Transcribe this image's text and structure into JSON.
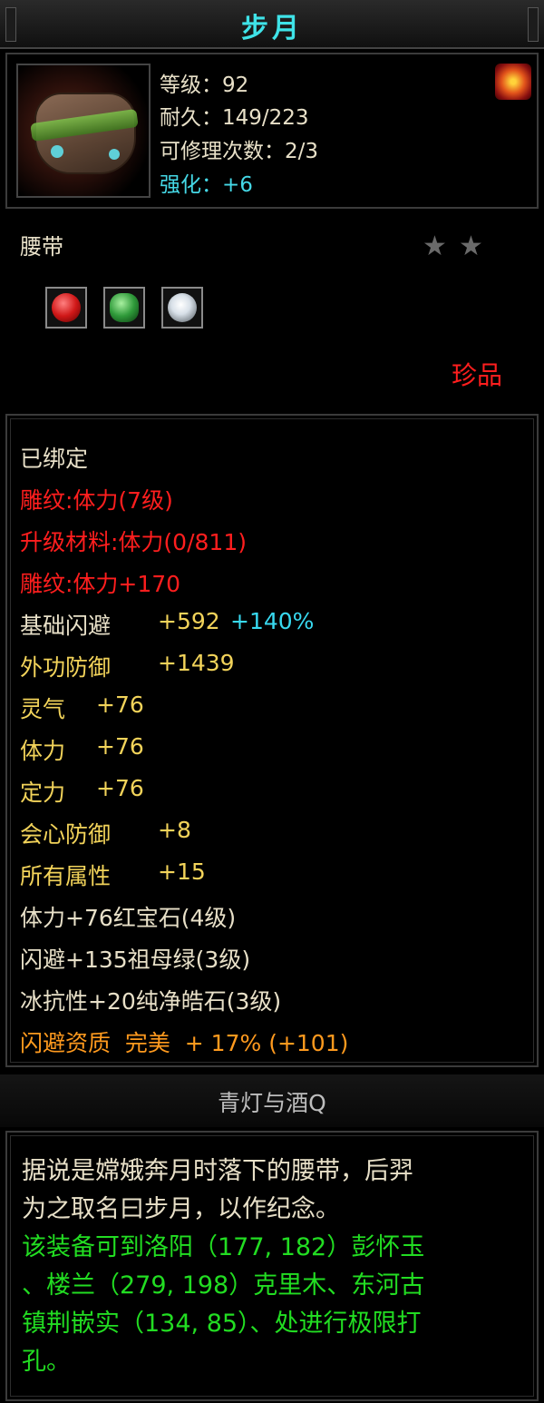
{
  "title": "步月",
  "item": {
    "image_icon": "belt-item-icon",
    "badge_icon": "fire-orb-icon",
    "level": "等级：92",
    "durability": "耐久：149/223",
    "repair": "可修理次数：2/3",
    "enhance": "强化：+6"
  },
  "type": "腰带",
  "stars": [
    "★",
    "★"
  ],
  "gems": [
    {
      "icon": "ruby-gem-icon",
      "color": "#d01818"
    },
    {
      "icon": "emerald-gem-icon",
      "color": "#2f9a3a"
    },
    {
      "icon": "diamond-gem-icon",
      "color": "#d8e0e8"
    }
  ],
  "rarity": "珍品",
  "attributes": {
    "bound": "已绑定",
    "carve1": "雕纹:体力(7级)",
    "upgrade": "升级材料:体力(0/811)",
    "carve2": "雕纹:体力+170",
    "dodge_label": "基础闪避",
    "dodge_value": "+592",
    "dodge_bonus": "+140%",
    "phys_def_label": "外功防御",
    "phys_def_value": "+1439",
    "spirit_label": "灵气",
    "spirit_value": "+76",
    "stamina_label": "体力",
    "stamina_value": "+76",
    "focus_label": "定力",
    "focus_value": "+76",
    "crit_def_label": "会心防御",
    "crit_def_value": "+8",
    "all_attr_label": "所有属性",
    "all_attr_value": "+15",
    "gem1": "体力+76红宝石(4级)",
    "gem2": "闪避+135祖母绿(3级)",
    "gem3": "冰抗性+20纯净皓石(3级)",
    "quality": "闪避资质  完美  + 17% (+101)"
  },
  "maker": "青灯与酒Q",
  "description": {
    "line1": "据说是嫦娥奔月时落下的腰带，后羿",
    "line2": "为之取名曰步月，以作纪念。",
    "line3": "该装备可到洛阳（177, 182）彭怀玉",
    "line4": "、楼兰（279, 198）克里木、东河古",
    "line5": "镇荆嵌实（134, 85）、处进行极限打",
    "line6": "孔。"
  }
}
